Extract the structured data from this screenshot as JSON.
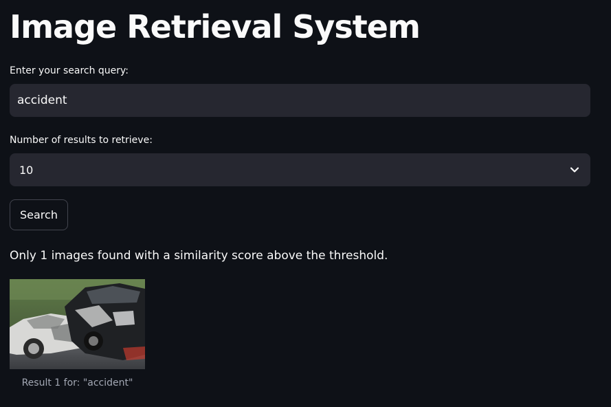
{
  "page": {
    "title": "Image Retrieval System"
  },
  "query": {
    "label": "Enter your search query:",
    "value": "accident"
  },
  "count": {
    "label": "Number of results to retrieve:",
    "selected": "10",
    "icon": "chevron-down-icon"
  },
  "search_button": {
    "label": "Search"
  },
  "status_message": "Only 1 images found with a similarity score above the threshold.",
  "results": [
    {
      "caption": "Result 1 for: \"accident\"",
      "image_desc": "two crashed cars"
    }
  ],
  "colors": {
    "background": "#0e1117",
    "field_bg": "#262730",
    "text": "#fafafa",
    "caption": "#a3a8b4"
  }
}
